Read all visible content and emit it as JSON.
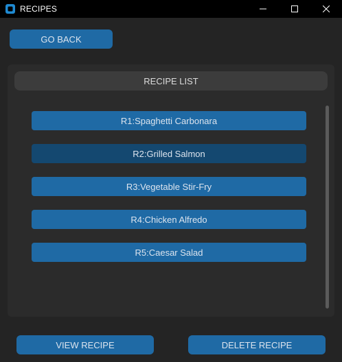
{
  "window": {
    "title": "RECIPES",
    "icon": "app-square-icon",
    "controls": [
      "minimize-icon",
      "maximize-icon",
      "close-icon"
    ]
  },
  "nav": {
    "go_back_label": "GO BACK"
  },
  "list": {
    "header": "RECIPE LIST",
    "items": [
      {
        "label": "R1:Spaghetti Carbonara",
        "selected": false
      },
      {
        "label": "R2:Grilled Salmon",
        "selected": true
      },
      {
        "label": "R3:Vegetable Stir-Fry",
        "selected": false
      },
      {
        "label": "R4:Chicken Alfredo",
        "selected": false
      },
      {
        "label": "R5:Caesar Salad",
        "selected": false
      }
    ]
  },
  "actions": {
    "view_label": "VIEW RECIPE",
    "delete_label": "DELETE RECIPE"
  },
  "colors": {
    "accent": "#1f6aa5",
    "accent_selected": "#144870",
    "background": "#242424",
    "frame": "#2b2b2b",
    "header": "#3c3c3c",
    "titlebar": "#000000"
  }
}
